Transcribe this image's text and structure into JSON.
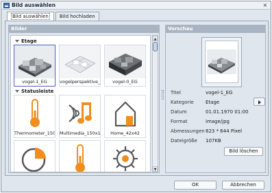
{
  "window": {
    "title": "Bild auswählen",
    "close_glyph": "×"
  },
  "tabs": [
    {
      "label": "Bild auswählen",
      "active": true
    },
    {
      "label": "Bild hochladen",
      "active": false
    }
  ],
  "left_panel": {
    "header": "Bilder",
    "groups": [
      {
        "name": "Etage",
        "items": [
          {
            "label": "vogel-1_EG",
            "selected": true
          },
          {
            "label": "vogelperspektive_...",
            "selected": false
          },
          {
            "label": "vogel-0_EG",
            "selected": false
          }
        ]
      },
      {
        "name": "Statusleiste",
        "items": [
          {
            "label": "Thermometer_150...",
            "icon": "thermometer-icon"
          },
          {
            "label": "Multimedia_150x1...",
            "icon": "multimedia-icon"
          },
          {
            "label": "Home_42x42",
            "icon": "home-icon"
          },
          {
            "label": "",
            "icon": "pie-chart-icon"
          },
          {
            "label": "",
            "icon": "thermometer-icon"
          },
          {
            "label": "",
            "icon": "gear-icon"
          }
        ]
      }
    ]
  },
  "right_panel": {
    "header": "Vorschau",
    "props": [
      {
        "label": "Titel",
        "value": "vogel-1_EG"
      },
      {
        "label": "Kategorie",
        "value": "Etage"
      },
      {
        "label": "Datum",
        "value": "01.01.1970 01:00"
      },
      {
        "label": "Format",
        "value": "image/jpg"
      },
      {
        "label": "Abmessungen",
        "value": "823 * 644 Pixel"
      },
      {
        "label": "Dateigröße",
        "value": "107KB"
      }
    ],
    "delete_button": "Bild löschen"
  },
  "footer": {
    "ok": "OK",
    "cancel": "Abbrechen"
  },
  "colors": {
    "accent_orange": "#f28c1b",
    "selection": "#4a5fc1",
    "header_bg": "#a8b4c2"
  }
}
